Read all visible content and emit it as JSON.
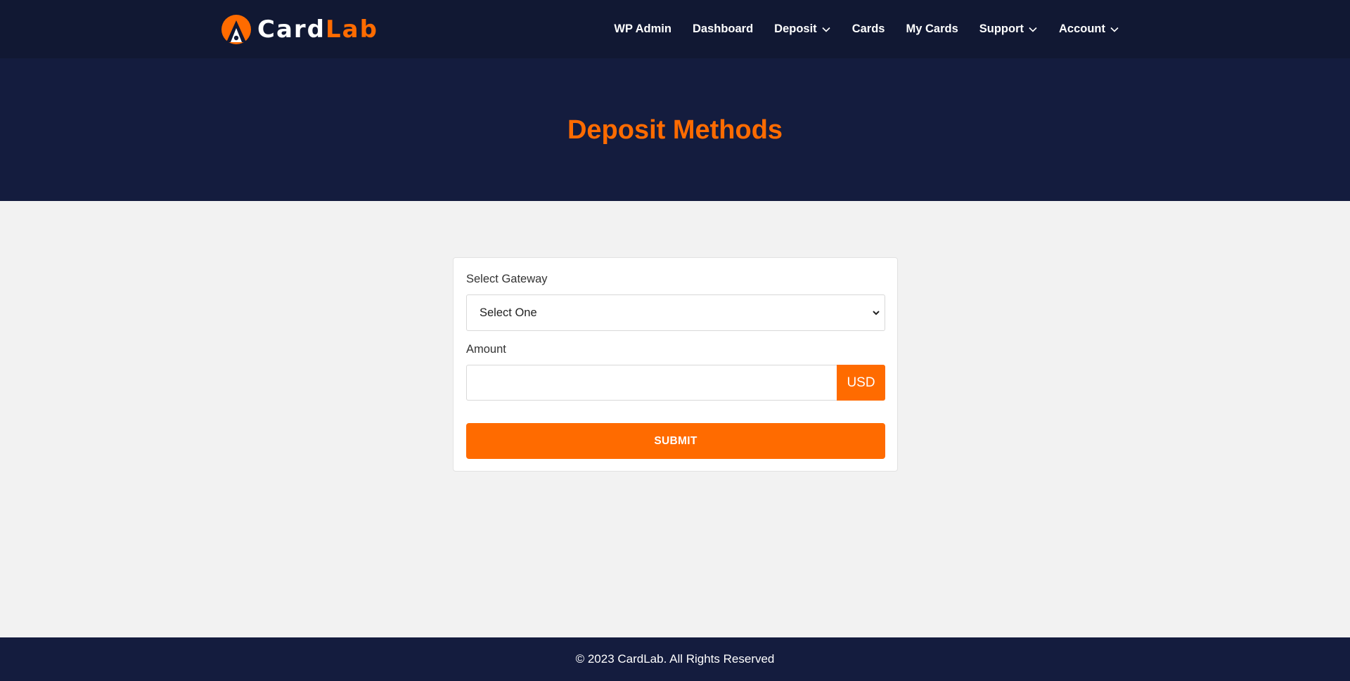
{
  "brand": {
    "name_part1": "Card",
    "name_part2": "Lab",
    "logo_icon": "cardlab-logo-icon",
    "colors": {
      "accent": "#ff6b00",
      "nav_bg": "#111833",
      "banner_bg": "#141c3e",
      "page_bg": "#f2f2f2"
    }
  },
  "nav": {
    "items": [
      {
        "label": "WP Admin",
        "dropdown": false
      },
      {
        "label": "Dashboard",
        "dropdown": false
      },
      {
        "label": "Deposit",
        "dropdown": true
      },
      {
        "label": "Cards",
        "dropdown": false
      },
      {
        "label": "My Cards",
        "dropdown": false
      },
      {
        "label": "Support",
        "dropdown": true
      },
      {
        "label": "Account",
        "dropdown": true
      }
    ]
  },
  "banner": {
    "title": "Deposit Methods"
  },
  "form": {
    "gateway_label": "Select Gateway",
    "gateway_selected": "Select One",
    "amount_label": "Amount",
    "amount_value": "",
    "currency": "USD",
    "submit_label": "SUBMIT"
  },
  "footer": {
    "text": "© 2023 CardLab. All Rights Reserved"
  }
}
